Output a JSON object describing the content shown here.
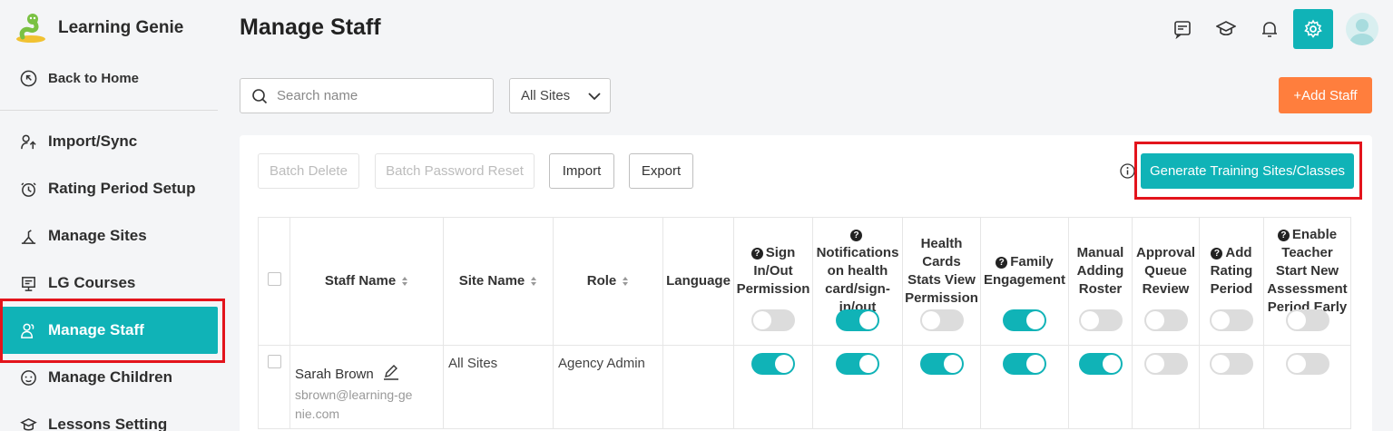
{
  "brand": {
    "name": "Learning Genie"
  },
  "sidebar": {
    "back_label": "Back to Home",
    "items": [
      {
        "label": "Import/Sync",
        "icon": "import-sync-icon",
        "active": false
      },
      {
        "label": "Rating Period Setup",
        "icon": "rating-period-icon",
        "active": false
      },
      {
        "label": "Manage Sites",
        "icon": "sites-icon",
        "active": false
      },
      {
        "label": "LG Courses",
        "icon": "courses-icon",
        "active": false
      },
      {
        "label": "Manage Staff",
        "icon": "staff-icon",
        "active": true
      },
      {
        "label": "Manage Children",
        "icon": "children-icon",
        "active": false
      },
      {
        "label": "Lessons Setting",
        "icon": "lessons-icon",
        "active": false
      }
    ]
  },
  "header": {
    "title": "Manage Staff",
    "icons": [
      "chat-list-icon",
      "graduation-cap-icon",
      "bell-icon",
      "settings-gear-icon",
      "user-avatar"
    ]
  },
  "filters": {
    "search_placeholder": "Search name",
    "site_select": "All Sites",
    "add_staff_label": "+Add Staff"
  },
  "toolbar": {
    "batch_delete": "Batch Delete",
    "batch_password_reset": "Batch Password Reset",
    "import": "Import",
    "export": "Export",
    "generate": "Generate Training Sites/Classes"
  },
  "table": {
    "columns": {
      "staff_name": "Staff Name",
      "site_name": "Site Name",
      "role": "Role",
      "language": "Language",
      "sign_in_out": "Sign In/Out Permission",
      "notifications": "Notifications on health card/sign-in/out",
      "health_cards": "Health Cards Stats View Permission",
      "family_engagement": "Family Engagement",
      "manual_adding": "Manual Adding Roster",
      "approval_queue": "Approval Queue Review",
      "add_rating": "Add Rating Period",
      "enable_teacher": "Enable Teacher Start New Assessment Period Early"
    },
    "header_toggles": [
      false,
      true,
      false,
      true,
      false,
      false,
      false,
      false
    ],
    "rows": [
      {
        "name": "Sarah Brown",
        "email": "sbrown@learning-genie.com",
        "site": "All Sites",
        "role": "Agency Admin",
        "language": "",
        "toggles": [
          true,
          true,
          true,
          true,
          true,
          false,
          false,
          false
        ]
      }
    ]
  },
  "colors": {
    "accent": "#10b3b7",
    "orange": "#ff7e3d",
    "highlight": "#e3141c"
  }
}
